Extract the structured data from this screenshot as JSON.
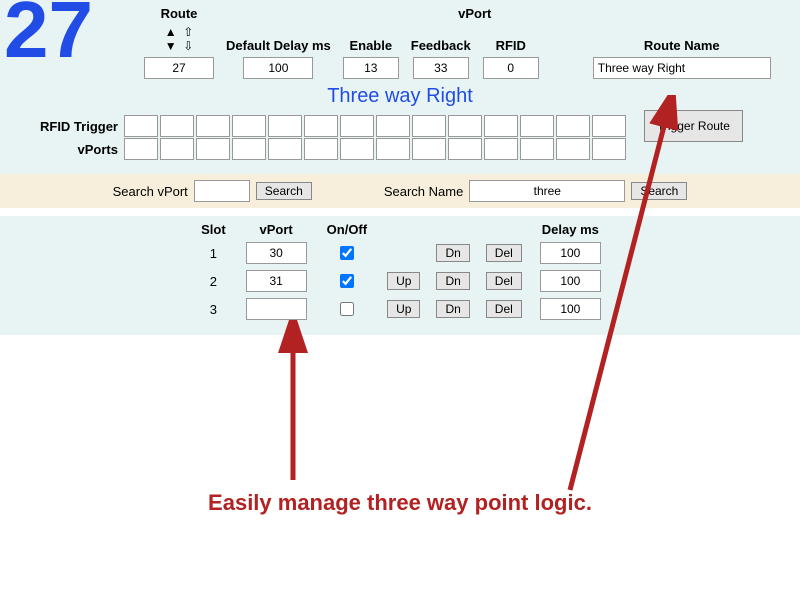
{
  "big_number": "27",
  "header": {
    "route_label": "Route",
    "default_delay_label": "Default Delay ms",
    "vport_group_label": "vPort",
    "enable_label": "Enable",
    "feedback_label": "Feedback",
    "rfid_label": "RFID",
    "route_name_label": "Route Name",
    "route_value": "27",
    "default_delay_value": "100",
    "enable_value": "13",
    "feedback_value": "33",
    "rfid_value": "0",
    "route_name_value": "Three way Right"
  },
  "route_title": "Three way Right",
  "rfid_trigger_label": "RFID Trigger",
  "vports_label": "vPorts",
  "trigger_route_btn": "Trigger Route",
  "search": {
    "vport_label": "Search vPort",
    "vport_value": "",
    "vport_btn": "Search",
    "name_label": "Search Name",
    "name_value": "three",
    "name_btn": "Search"
  },
  "slots_header": {
    "slot": "Slot",
    "vport": "vPort",
    "onoff": "On/Off",
    "delay": "Delay ms"
  },
  "slots": [
    {
      "slot": "1",
      "vport": "30",
      "on": true,
      "up": false,
      "dn": true,
      "del": true,
      "delay": "100"
    },
    {
      "slot": "2",
      "vport": "31",
      "on": true,
      "up": true,
      "dn": true,
      "del": true,
      "delay": "100"
    },
    {
      "slot": "3",
      "vport": "",
      "on": false,
      "up": true,
      "dn": true,
      "del": true,
      "delay": "100"
    }
  ],
  "btns": {
    "up": "Up",
    "dn": "Dn",
    "del": "Del"
  },
  "caption": "Easily manage three way point logic."
}
